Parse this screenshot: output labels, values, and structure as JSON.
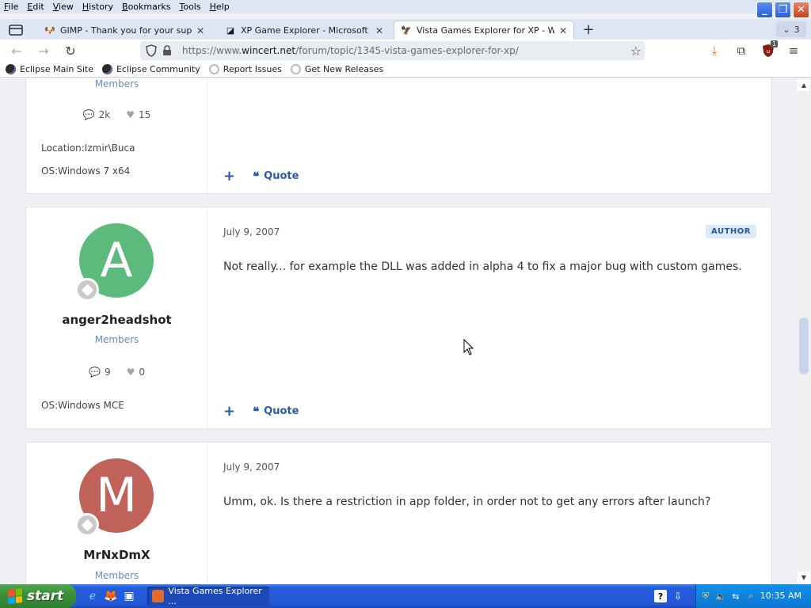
{
  "menu": {
    "items": [
      {
        "label": "File",
        "key": "F",
        "rest": "ile"
      },
      {
        "label": "Edit",
        "key": "E",
        "rest": "dit"
      },
      {
        "label": "View",
        "key": "V",
        "rest": "iew"
      },
      {
        "label": "History",
        "key": "H",
        "rest": "istory"
      },
      {
        "label": "Bookmarks",
        "key": "B",
        "rest": "ookmarks"
      },
      {
        "label": "Tools",
        "key": "T",
        "rest": "ools"
      },
      {
        "label": "Help",
        "key": "H",
        "rest": "elp"
      }
    ]
  },
  "tabs": [
    {
      "title": "GIMP -      Thank you for your supp",
      "icon": "gimp-icon",
      "active": false
    },
    {
      "title": "XP Game Explorer - Microsoft (Wind",
      "icon": "page-icon",
      "active": false
    },
    {
      "title": "Vista Games Explorer for XP - Wind",
      "icon": "wincert-icon",
      "active": true
    }
  ],
  "tab_count": "3",
  "address": {
    "prefix": "https://www.",
    "domain": "wincert.net",
    "path": "/forum/topic/1345-vista-games-explorer-for-xp/"
  },
  "bookmarks": [
    {
      "label": "Eclipse Main Site",
      "icon": "eclipse-icon"
    },
    {
      "label": "Eclipse Community",
      "icon": "eclipse-icon"
    },
    {
      "label": "Report Issues",
      "icon": "github-icon"
    },
    {
      "label": "Get New Releases",
      "icon": "github-icon"
    }
  ],
  "extension_badge": "1",
  "posts": [
    {
      "group": "Members",
      "stats": {
        "posts": "2k",
        "reputation": "15"
      },
      "location": "Location:Izmir\\Buca",
      "os": "OS:Windows 7 x64",
      "actions": {
        "plus": "+",
        "quote": "Quote"
      }
    },
    {
      "avatar_letter": "A",
      "avatar_color": "#5cba7d",
      "username": "anger2headshot",
      "group": "Members",
      "stats": {
        "posts": "9",
        "reputation": "0"
      },
      "os": "OS:Windows MCE",
      "date": "July 9, 2007",
      "badge": "AUTHOR",
      "body": "Not really... for example the DLL was added in alpha 4 to fix a major bug with custom games.",
      "actions": {
        "plus": "+",
        "quote": "Quote"
      }
    },
    {
      "avatar_letter": "M",
      "avatar_color": "#c0615a",
      "username": "MrNxDmX",
      "group": "Members",
      "date": "July 9, 2007",
      "body": "Umm, ok. Is there a restriction in app folder, in order not to get any errors after launch?"
    }
  ],
  "taskbar": {
    "start_label": "start",
    "task_label": "Vista Games Explorer ...",
    "clock": "10:35 AM"
  },
  "colors": {
    "link_blue": "#2b5aa8",
    "group_blue": "#6c8bbd",
    "xp_blue": "#2357d6",
    "xp_green": "#3b913b"
  }
}
